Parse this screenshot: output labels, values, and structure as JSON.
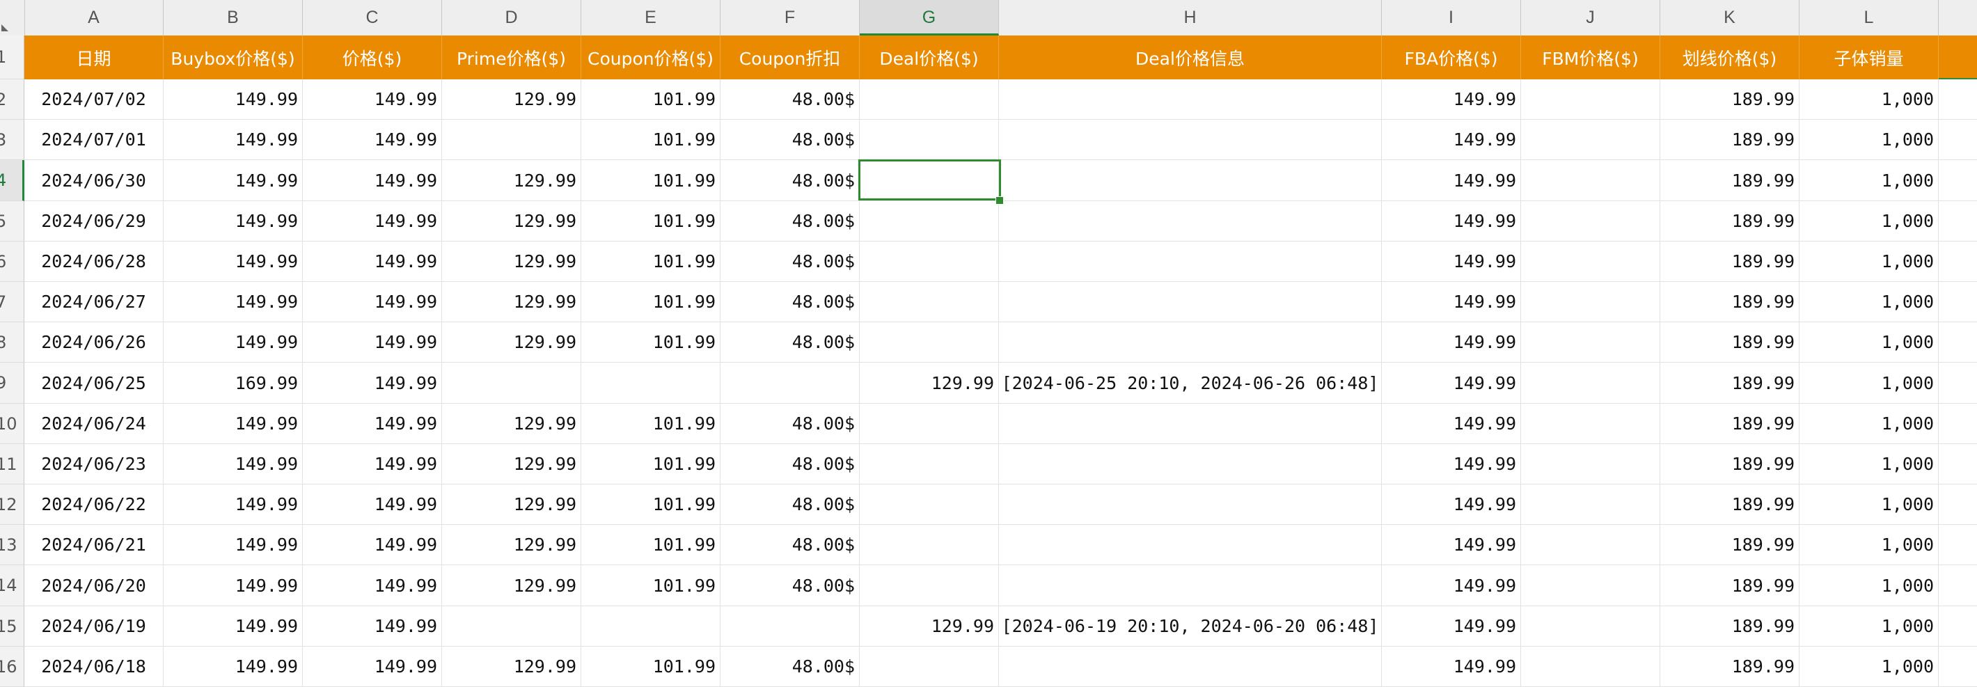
{
  "column_letters": [
    "A",
    "B",
    "C",
    "D",
    "E",
    "F",
    "G",
    "H",
    "I",
    "J",
    "K",
    "L"
  ],
  "active_column": "G",
  "header_row_number": "1",
  "headers": [
    "日期",
    "Buybox价格($)",
    "价格($)",
    "Prime价格($)",
    "Coupon价格($)",
    "Coupon折扣",
    "Deal价格($)",
    "Deal价格信息",
    "FBA价格($)",
    "FBM价格($)",
    "划线价格($)",
    "子体销量"
  ],
  "rows": [
    {
      "n": "2",
      "cells": [
        "2024/07/02",
        "149.99",
        "149.99",
        "129.99",
        "101.99",
        "48.00$",
        "",
        "",
        "149.99",
        "",
        "189.99",
        "1,000"
      ]
    },
    {
      "n": "3",
      "cells": [
        "2024/07/01",
        "149.99",
        "149.99",
        "",
        "101.99",
        "48.00$",
        "",
        "",
        "149.99",
        "",
        "189.99",
        "1,000"
      ]
    },
    {
      "n": "4",
      "cells": [
        "2024/06/30",
        "149.99",
        "149.99",
        "129.99",
        "101.99",
        "48.00$",
        "",
        "",
        "149.99",
        "",
        "189.99",
        "1,000"
      ]
    },
    {
      "n": "5",
      "cells": [
        "2024/06/29",
        "149.99",
        "149.99",
        "129.99",
        "101.99",
        "48.00$",
        "",
        "",
        "149.99",
        "",
        "189.99",
        "1,000"
      ]
    },
    {
      "n": "6",
      "cells": [
        "2024/06/28",
        "149.99",
        "149.99",
        "129.99",
        "101.99",
        "48.00$",
        "",
        "",
        "149.99",
        "",
        "189.99",
        "1,000"
      ]
    },
    {
      "n": "7",
      "cells": [
        "2024/06/27",
        "149.99",
        "149.99",
        "129.99",
        "101.99",
        "48.00$",
        "",
        "",
        "149.99",
        "",
        "189.99",
        "1,000"
      ]
    },
    {
      "n": "8",
      "cells": [
        "2024/06/26",
        "149.99",
        "149.99",
        "129.99",
        "101.99",
        "48.00$",
        "",
        "",
        "149.99",
        "",
        "189.99",
        "1,000"
      ]
    },
    {
      "n": "9",
      "cells": [
        "2024/06/25",
        "169.99",
        "149.99",
        "",
        "",
        "",
        "129.99",
        "[2024-06-25 20:10, 2024-06-26 06:48]",
        "149.99",
        "",
        "189.99",
        "1,000"
      ]
    },
    {
      "n": "10",
      "cells": [
        "2024/06/24",
        "149.99",
        "149.99",
        "129.99",
        "101.99",
        "48.00$",
        "",
        "",
        "149.99",
        "",
        "189.99",
        "1,000"
      ]
    },
    {
      "n": "11",
      "cells": [
        "2024/06/23",
        "149.99",
        "149.99",
        "129.99",
        "101.99",
        "48.00$",
        "",
        "",
        "149.99",
        "",
        "189.99",
        "1,000"
      ]
    },
    {
      "n": "12",
      "cells": [
        "2024/06/22",
        "149.99",
        "149.99",
        "129.99",
        "101.99",
        "48.00$",
        "",
        "",
        "149.99",
        "",
        "189.99",
        "1,000"
      ]
    },
    {
      "n": "13",
      "cells": [
        "2024/06/21",
        "149.99",
        "149.99",
        "129.99",
        "101.99",
        "48.00$",
        "",
        "",
        "149.99",
        "",
        "189.99",
        "1,000"
      ]
    },
    {
      "n": "14",
      "cells": [
        "2024/06/20",
        "149.99",
        "149.99",
        "129.99",
        "101.99",
        "48.00$",
        "",
        "",
        "149.99",
        "",
        "189.99",
        "1,000"
      ]
    },
    {
      "n": "15",
      "cells": [
        "2024/06/19",
        "149.99",
        "149.99",
        "",
        "",
        "",
        "129.99",
        "[2024-06-19 20:10, 2024-06-20 06:48]",
        "149.99",
        "",
        "189.99",
        "1,000"
      ]
    },
    {
      "n": "16",
      "cells": [
        "2024/06/18",
        "149.99",
        "149.99",
        "129.99",
        "101.99",
        "48.00$",
        "",
        "",
        "149.99",
        "",
        "189.99",
        "1,000"
      ]
    }
  ],
  "active_row": "4",
  "colors": {
    "header_bg": "#ea8a00",
    "header_text": "#ffffff",
    "selection": "#2e8b2e",
    "grid": "#e2e2e2"
  }
}
